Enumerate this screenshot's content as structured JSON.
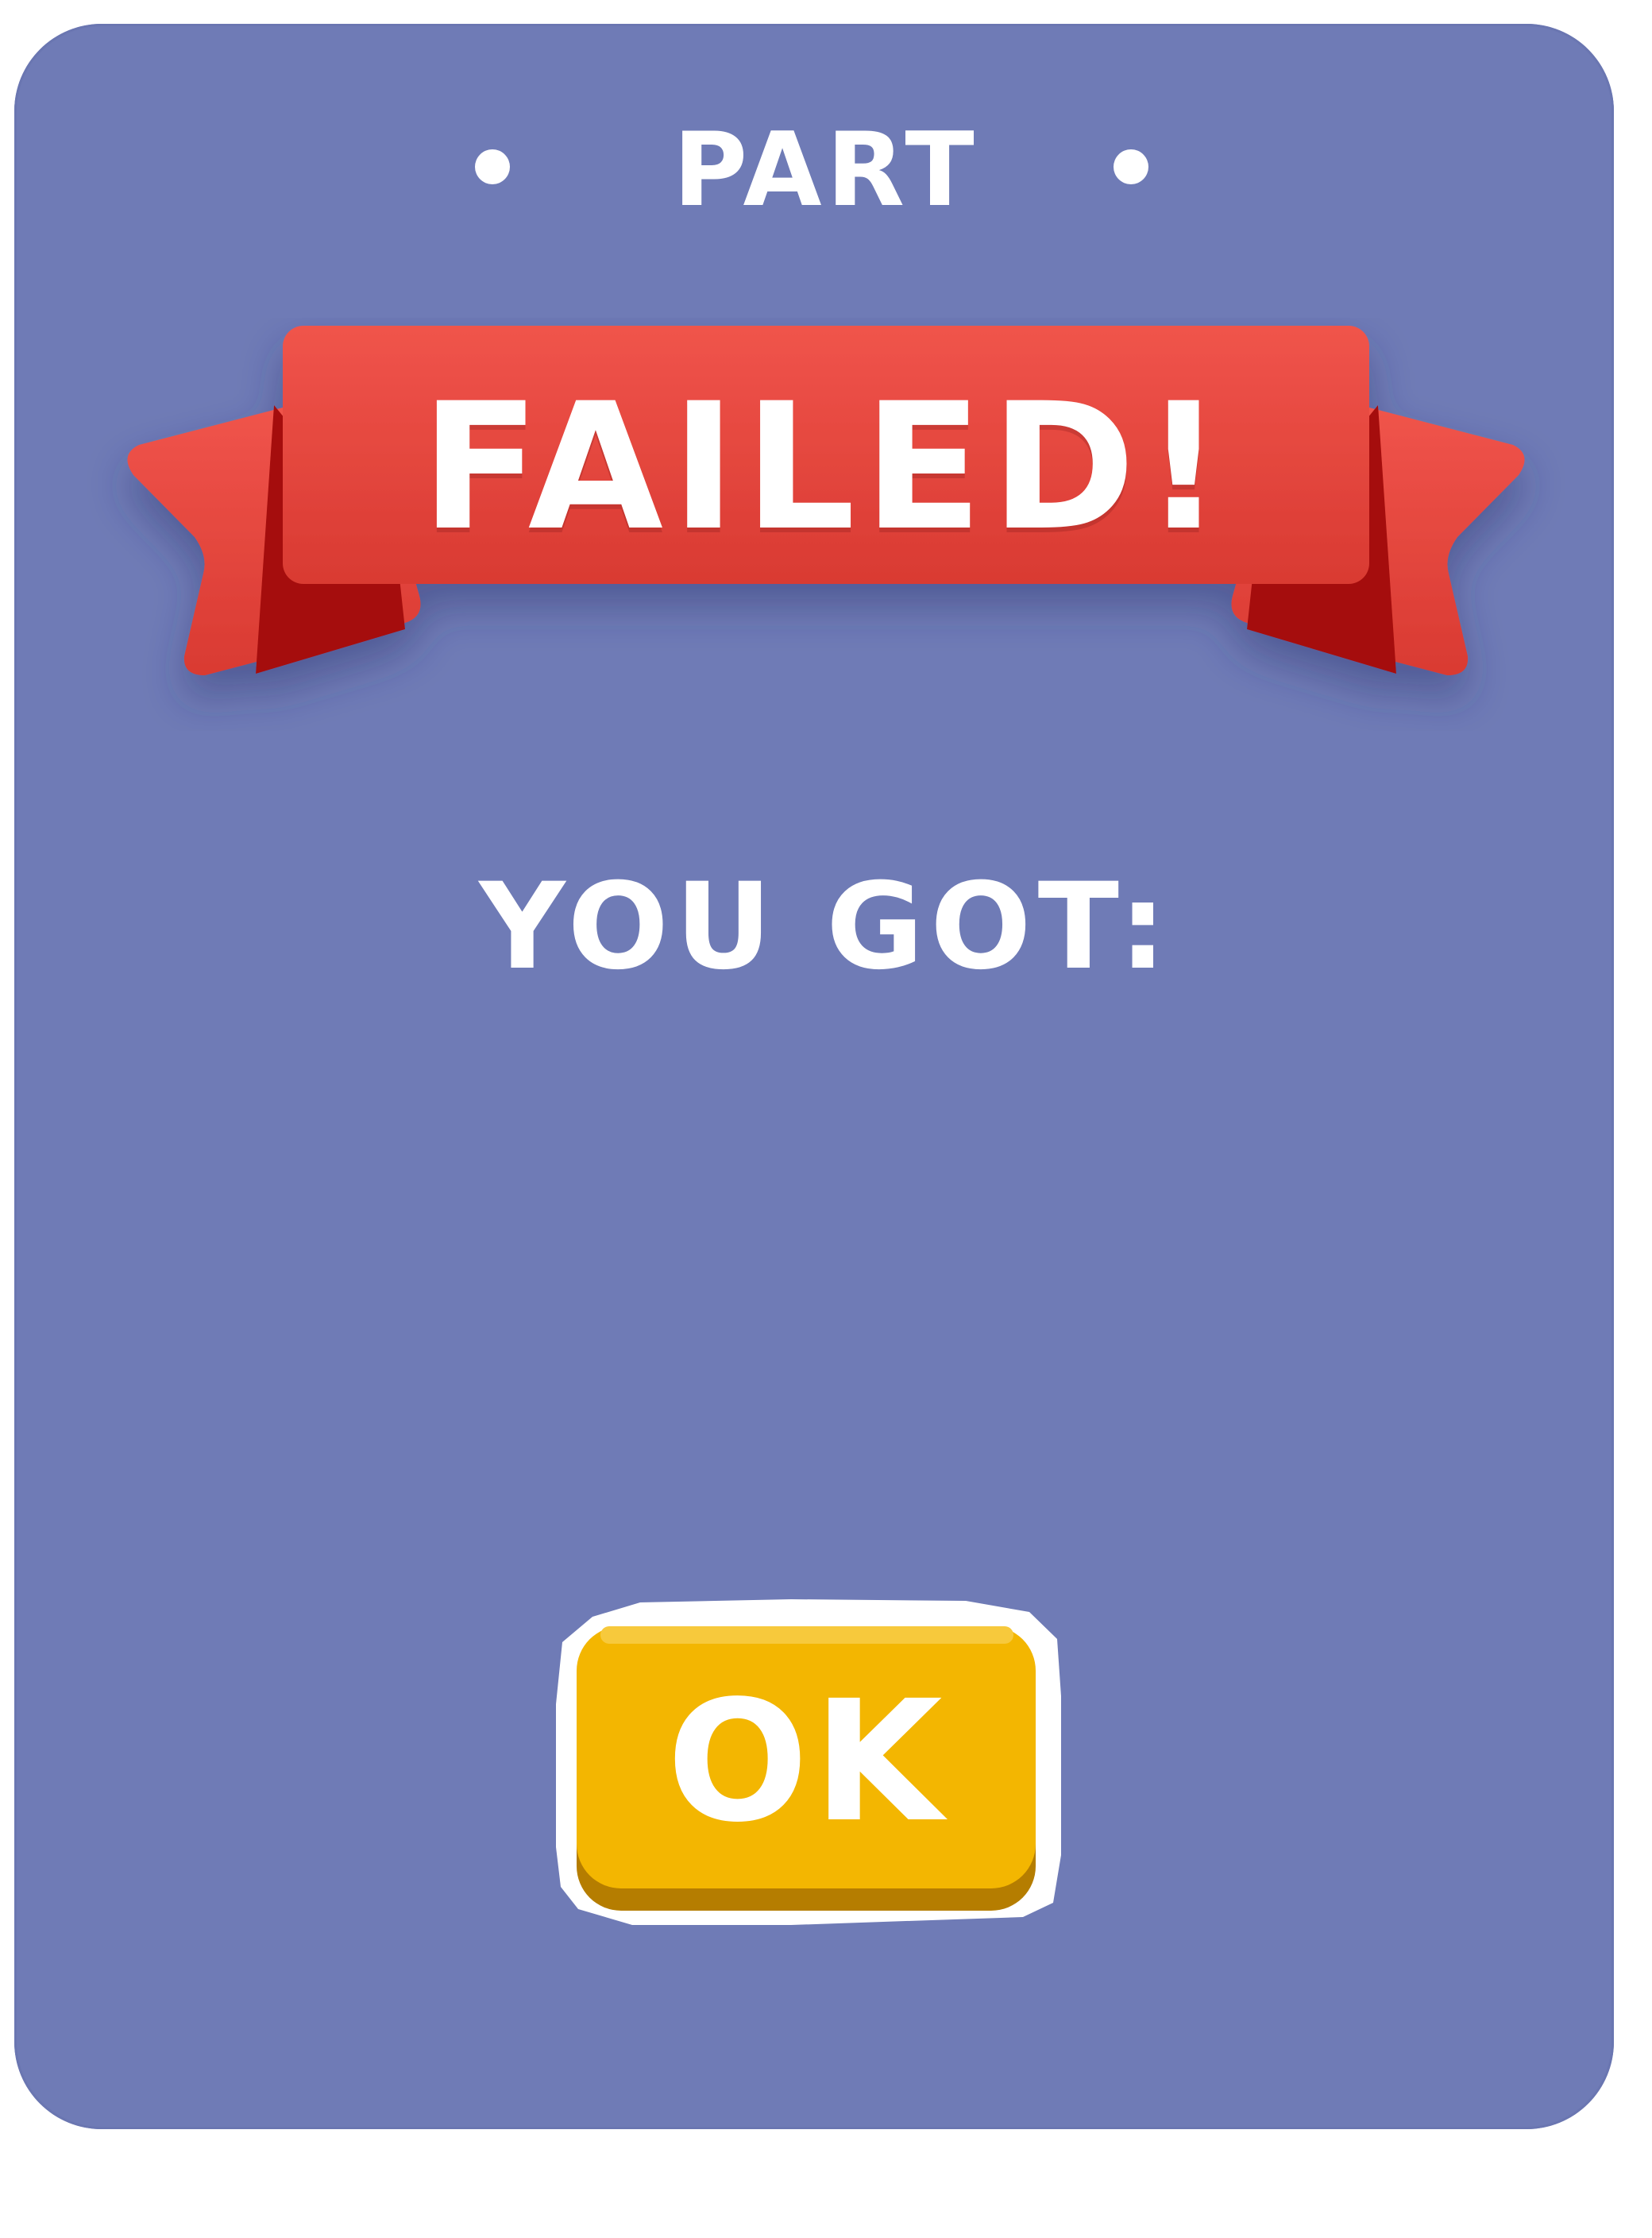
{
  "header": {
    "label": "PART"
  },
  "banner": {
    "title": "FAILED!"
  },
  "result": {
    "label": "YOU GOT:"
  },
  "actions": {
    "ok_label": "OK"
  },
  "colors": {
    "panel": "#6f7bb6",
    "ribbon_main": "#e84c43",
    "ribbon_dark": "#a5100c",
    "button": "#f3b601",
    "button_shadow": "#b57d00",
    "text": "#ffffff"
  }
}
